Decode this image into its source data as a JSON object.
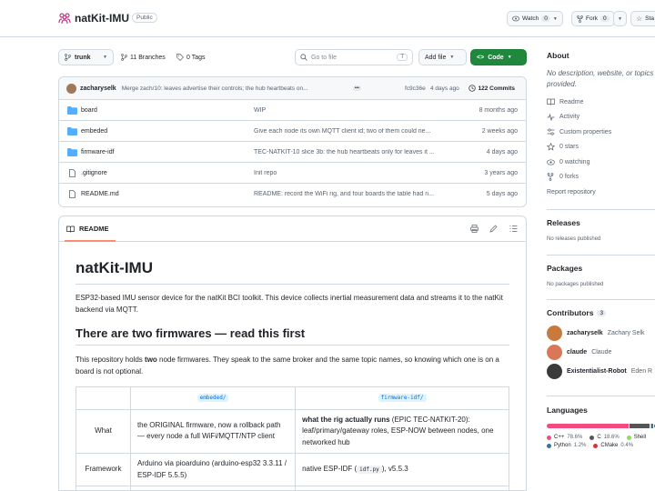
{
  "repo": {
    "owner_icon": "people-icon",
    "name": "natKit-IMU",
    "visibility": "Public"
  },
  "header": {
    "watch_label": "Watch",
    "watch_count": "0",
    "fork_label": "Fork",
    "fork_count": "0",
    "star_label": "Sta"
  },
  "toolbar": {
    "branch": "trunk",
    "branches": "11 Branches",
    "tags": "0 Tags",
    "search_placeholder": "Go to file",
    "search_key": "T",
    "add_file": "Add file",
    "code": "Code"
  },
  "commit": {
    "author": "zacharyselk",
    "message": "Merge zach/10: leaves advertise their controls; the hub heartbeats on...",
    "ellipsis": "•••",
    "sha": "fc9c36e",
    "time": "4 days ago",
    "count": "122 Commits"
  },
  "files": [
    {
      "name": "board",
      "type": "dir",
      "message": "WIP",
      "date": "8 months ago"
    },
    {
      "name": "embeded",
      "type": "dir",
      "message": "Give each node its own MQTT client id; two of them could ne...",
      "date": "2 weeks ago"
    },
    {
      "name": "firmware-idf",
      "type": "dir",
      "message": "TEC-NATKIT-10 slice 3b: the hub heartbeats only for leaves it ...",
      "date": "4 days ago"
    },
    {
      "name": ".gitignore",
      "type": "file",
      "message": "Init repo",
      "date": "3 years ago"
    },
    {
      "name": "README.md",
      "type": "file",
      "message": "README: record the WiFi rig, and four boards the table had n...",
      "date": "5 days ago"
    }
  ],
  "readme": {
    "tab": "README",
    "title": "natKit-IMU",
    "intro": "ESP32-based IMU sensor device for the natKit BCI toolkit. This device collects inertial measurement data and streams it to the natKit backend via MQTT.",
    "h2": "There are two firmwares — read this first",
    "p2_a": "This repository holds ",
    "p2_b": "two",
    "p2_c": " node firmwares. They speak to the same broker and the same topic names, so knowing which one is on a board is not optional.",
    "table": {
      "col1": "embeded/",
      "col2": "firmware-idf/",
      "row1_label": "What",
      "row1_c1": "the ORIGINAL firmware, now a rollback path — every node a full WiFi/MQTT/NTP client",
      "row1_c2_bold": "what the rig actually runs",
      "row1_c2_rest": " (EPIC TEC-NATKIT-20): leaf/primary/gateway roles, ESP-NOW between nodes, one networked hub",
      "row2_label": "Framework",
      "row2_c1": "Arduino via pioarduino (arduino-esp32 3.3.11 / ESP-IDF 5.5.5)",
      "row2_c2_a": "native ESP-IDF (",
      "row2_c2_code": "idf.py",
      "row2_c2_b": "), v5.5.3"
    }
  },
  "sidebar": {
    "about_title": "About",
    "about_desc": "No description, website, or topics provided.",
    "links": [
      {
        "icon": "book-icon",
        "label": "Readme"
      },
      {
        "icon": "pulse-icon",
        "label": "Activity"
      },
      {
        "icon": "sliders-icon",
        "label": "Custom properties"
      },
      {
        "icon": "star-icon",
        "label": "0 stars"
      },
      {
        "icon": "eye-icon",
        "label": "0 watching"
      },
      {
        "icon": "fork-icon",
        "label": "0 forks"
      }
    ],
    "report": "Report repository",
    "releases_title": "Releases",
    "releases_empty": "No releases published",
    "packages_title": "Packages",
    "packages_empty": "No packages published",
    "contributors_title": "Contributors",
    "contributors_count": "3",
    "contributors": [
      {
        "login": "zacharyselk",
        "name": "Zachary Selk",
        "color": "#c87a3c"
      },
      {
        "login": "claude",
        "name": "Claude",
        "color": "#d97757"
      },
      {
        "login": "Existentialist-Robot",
        "name": "Eden R",
        "color": "#3a3a3a"
      }
    ],
    "languages_title": "Languages",
    "languages": [
      {
        "name": "C++",
        "pct": "78.6%",
        "color": "#f34b7d",
        "value": 78.6
      },
      {
        "name": "C",
        "pct": "18.6%",
        "color": "#555555",
        "value": 18.6
      },
      {
        "name": "Shell",
        "pct": "",
        "color": "#89e051",
        "value": 0.4
      },
      {
        "name": "Python",
        "pct": "1.2%",
        "color": "#3572A5",
        "value": 1.2
      },
      {
        "name": "CMake",
        "pct": "0.4%",
        "color": "#DA3434",
        "value": 0.4
      }
    ]
  }
}
